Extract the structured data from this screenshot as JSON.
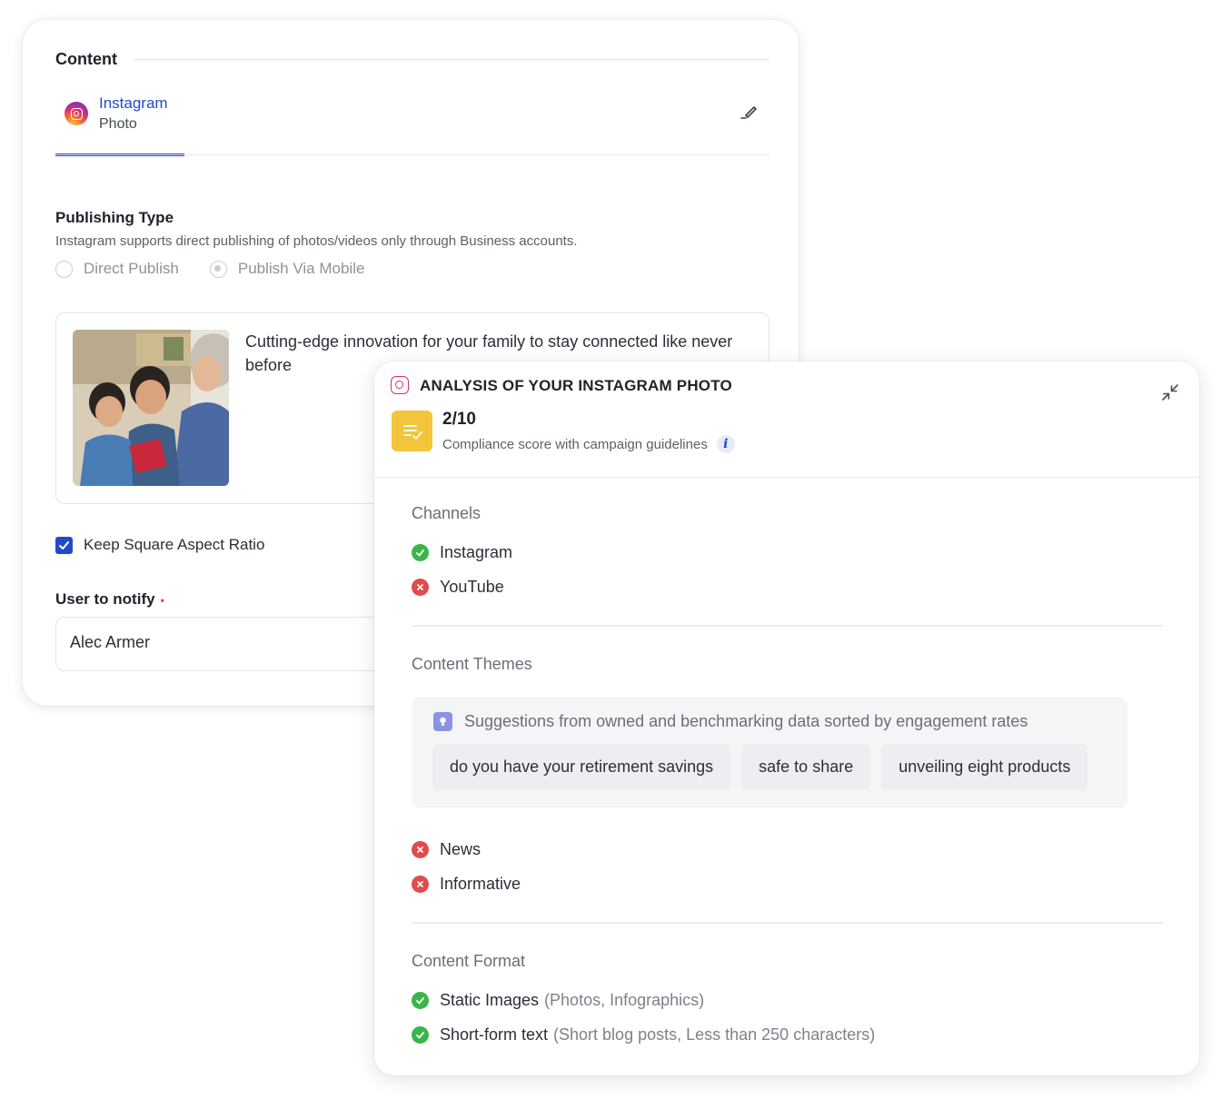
{
  "composer": {
    "section_title": "Content",
    "channel": {
      "name": "Instagram",
      "type": "Photo"
    },
    "publishing": {
      "title": "Publishing Type",
      "description": "Instagram supports direct publishing of photos/videos only through Business accounts.",
      "options": [
        {
          "label": "Direct Publish",
          "selected": false
        },
        {
          "label": "Publish Via Mobile",
          "selected": true
        }
      ]
    },
    "post": {
      "caption": "Cutting-edge innovation for your family to stay connected like never before"
    },
    "keep_square": {
      "label": "Keep Square Aspect Ratio",
      "checked": true
    },
    "notify": {
      "label": "User to notify",
      "required_mark": "•",
      "value": "Alec Armer"
    }
  },
  "analysis": {
    "title": "ANALYSIS OF YOUR INSTAGRAM PHOTO",
    "score": "2/10",
    "score_label": "Compliance score with campaign guidelines",
    "info_glyph": "i",
    "channels": {
      "title": "Channels",
      "items": [
        {
          "label": "Instagram",
          "status": "ok"
        },
        {
          "label": "YouTube",
          "status": "bad"
        }
      ]
    },
    "themes": {
      "title": "Content Themes",
      "suggestion_text": "Suggestions from owned and benchmarking data sorted by engagement rates",
      "chips": [
        "do you have your retirement savings",
        "safe to share",
        "unveiling eight products"
      ],
      "items": [
        {
          "label": "News",
          "status": "bad"
        },
        {
          "label": "Informative",
          "status": "bad"
        }
      ]
    },
    "format": {
      "title": "Content Format",
      "items": [
        {
          "label": "Static Images",
          "detail": "(Photos, Infographics)",
          "status": "ok"
        },
        {
          "label": "Short-form text",
          "detail": "(Short blog posts, Less than 250 characters)",
          "status": "ok"
        }
      ]
    }
  },
  "colors": {
    "accent": "#2349c9",
    "ok": "#3bb54a",
    "bad": "#e24b4b",
    "score_badge": "#f2c53a"
  }
}
